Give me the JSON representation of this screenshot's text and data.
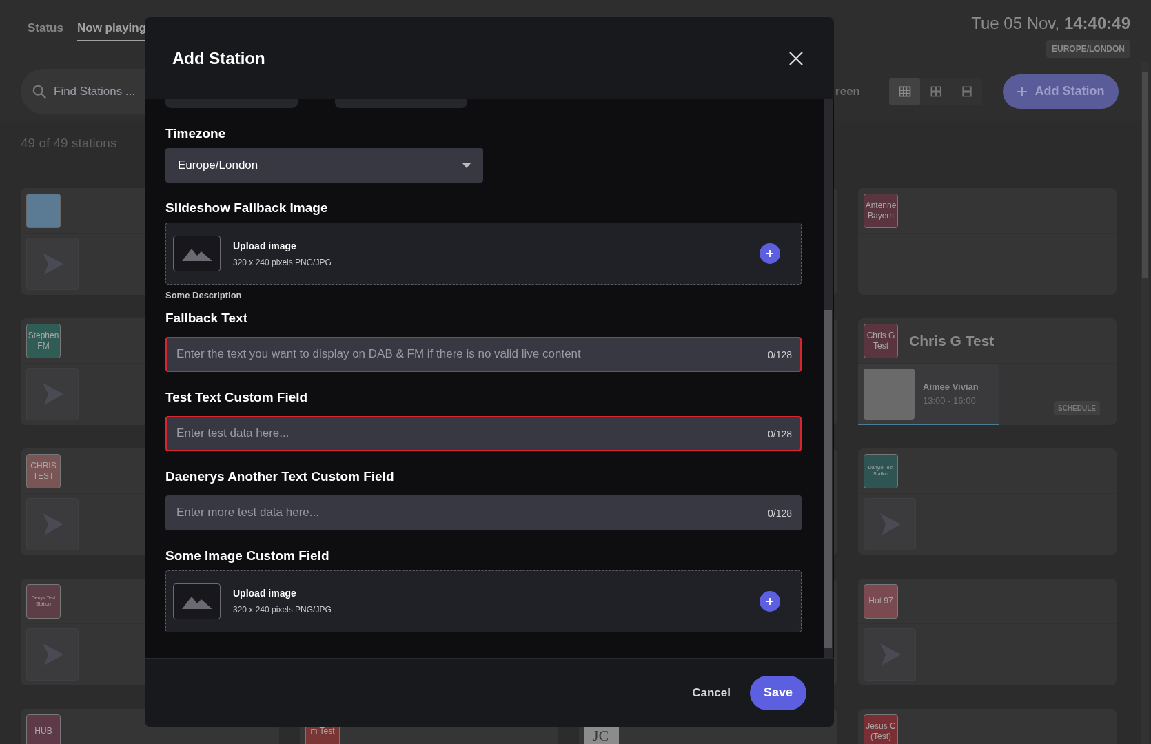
{
  "header": {
    "tabs": [
      {
        "label": "Status",
        "selected": false
      },
      {
        "label": "Now playing",
        "selected": true
      }
    ],
    "clock": "Tue 05 Nov, **14:40:49**",
    "timezone": "EUROPE/LONDON"
  },
  "toolbar": {
    "search": {
      "placeholder": "Find Stations ..."
    },
    "partial_button": "reen",
    "view_toggles": [
      {
        "kind": "grid3",
        "selected": true
      },
      {
        "kind": "grid2",
        "selected": false
      },
      {
        "kind": "rows",
        "selected": false
      }
    ],
    "add_button": "Add Station"
  },
  "station_count": "49 of 49 stations",
  "columns": [
    {
      "cards": [
        {
          "kind": "player",
          "logo": {
            "kind": "picture",
            "color": "#5b7a94"
          }
        },
        {
          "kind": "player",
          "logo": {
            "kind": "text",
            "text": "Stephen FM",
            "color": "#2f5c55"
          }
        },
        {
          "kind": "player",
          "logo": {
            "kind": "text",
            "text": "CHRIS TEST",
            "color": "#7a5556"
          }
        },
        {
          "kind": "player",
          "logo": {
            "kind": "text",
            "text": "Denys Test Station",
            "color": "#5e3e46"
          }
        },
        {
          "kind": "logo_only",
          "logo": {
            "kind": "text",
            "text": "HUB",
            "color": "#5e3a48"
          }
        }
      ]
    },
    {
      "cards": [
        {
          "kind": "logo_only",
          "logo": {
            "kind": "text",
            "text": "m Test",
            "color": "#7a3535"
          }
        }
      ]
    },
    {
      "cards": [
        {
          "kind": "logo_only",
          "logo": {
            "kind": "mark",
            "text": "JC",
            "color": "#8c8c8c"
          }
        }
      ]
    },
    {
      "cards": [
        {
          "kind": "logo_only",
          "logo": {
            "kind": "text",
            "text": "Antenne Bayern",
            "color": "#5a3540"
          }
        },
        {
          "kind": "show",
          "logo": {
            "kind": "text",
            "text": "Chris G Test",
            "color": "#5a3540"
          },
          "title": "Chris G Test",
          "show": {
            "host": "Aimee Vivian",
            "time": "13:00 - 16:00"
          },
          "schedule": "SCHEDULE"
        },
        {
          "kind": "player",
          "logo": {
            "kind": "text",
            "text": "Danylo Test Station",
            "color": "#2e5554"
          }
        },
        {
          "kind": "player",
          "logo": {
            "kind": "text",
            "text": "Hot 97",
            "color": "#7a4a50"
          }
        },
        {
          "kind": "logo_only",
          "logo": {
            "kind": "text",
            "text": "Jesus C (Test)",
            "color": "#7a2f35"
          }
        }
      ]
    }
  ],
  "dialog": {
    "title": "Add Station",
    "sections": [
      {
        "kind": "select",
        "label": "Timezone",
        "value": "Europe/London"
      },
      {
        "kind": "upload",
        "label": "Slideshow Fallback Image",
        "title": "Upload image",
        "hint": "320 x 240 pixels PNG/JPG",
        "description": "Some Description"
      },
      {
        "kind": "text",
        "label": "Fallback Text",
        "placeholder": "Enter the text you want to display on DAB & FM if there is no valid live content",
        "counter": "0/128",
        "error": true
      },
      {
        "kind": "text",
        "label": "Test Text Custom Field",
        "placeholder": "Enter test data here...",
        "counter": "0/128",
        "error": true
      },
      {
        "kind": "text",
        "label": "Daenerys Another Text Custom Field",
        "placeholder": "Enter more test data here...",
        "counter": "0/128",
        "error": false
      },
      {
        "kind": "upload",
        "label": "Some Image Custom Field",
        "title": "Upload image",
        "hint": "320 x 240 pixels PNG/JPG"
      }
    ],
    "cancel": "Cancel",
    "save": "Save"
  }
}
